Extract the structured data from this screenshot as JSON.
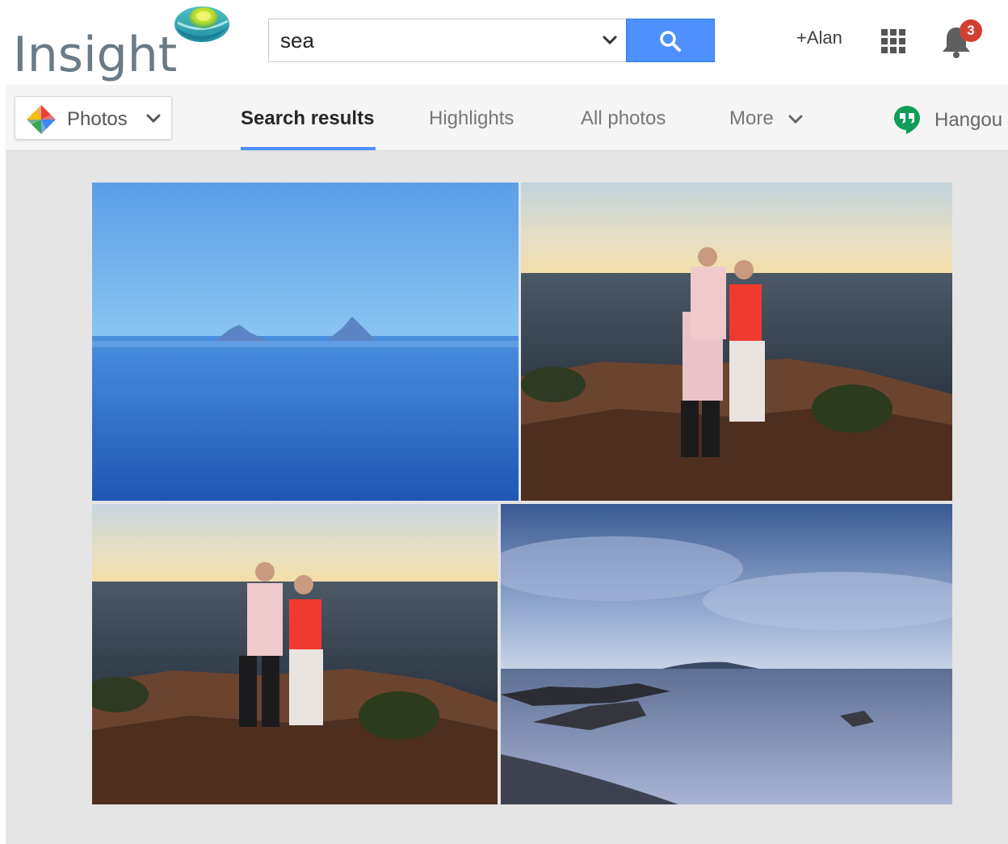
{
  "header": {
    "logo_text": "Insight",
    "search": {
      "value": "sea",
      "button_icon": "search-icon",
      "dropdown_icon": "chevron-down-icon"
    },
    "user_label": "+Alan",
    "apps_icon": "apps-grid-icon",
    "notifications": {
      "icon": "bell-icon",
      "count": "3"
    }
  },
  "subnav": {
    "app_switcher": {
      "label": "Photos",
      "icon": "photos-pinwheel-icon"
    },
    "tabs": [
      {
        "label": "Search results",
        "active": true
      },
      {
        "label": "Highlights",
        "active": false
      },
      {
        "label": "All photos",
        "active": false
      },
      {
        "label": "More",
        "active": false
      }
    ],
    "hangouts_label": "Hangou"
  },
  "results": {
    "photos": [
      {
        "subject": "misty blue sea with two rocky islands"
      },
      {
        "subject": "couple standing on coastal rocks at sunset"
      },
      {
        "subject": "couple standing on coastal rocks at sunset"
      },
      {
        "subject": "long-exposure seascape with rocks under cloudy sky"
      }
    ]
  },
  "colors": {
    "accent": "#4d90fe",
    "badge": "#d23f31",
    "content_bg": "#e5e5e5"
  }
}
